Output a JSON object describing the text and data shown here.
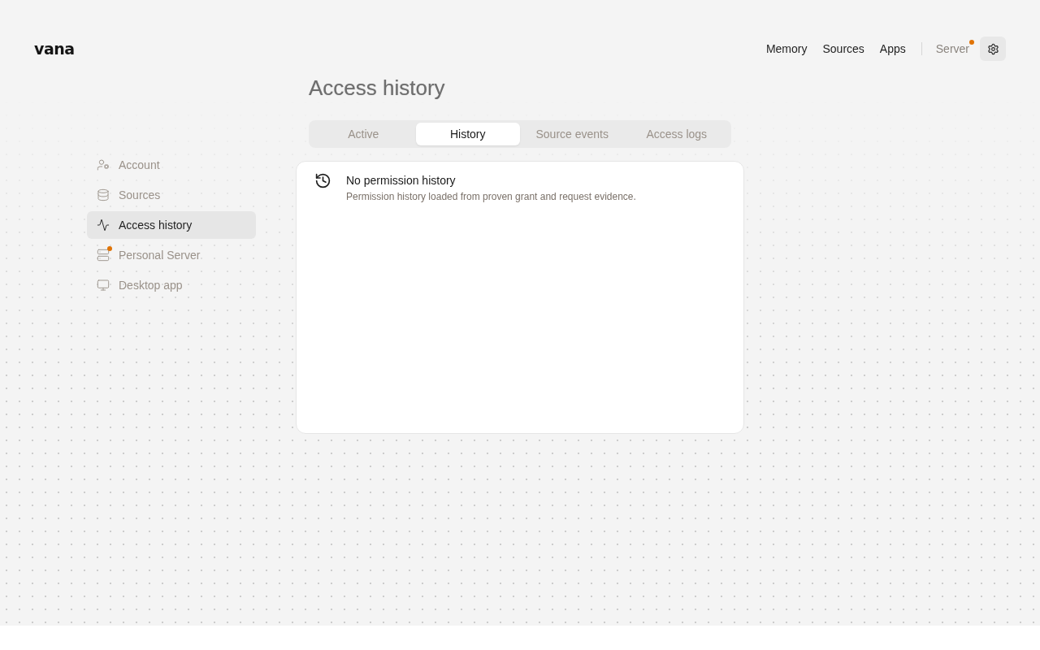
{
  "logo": {
    "text": "vana"
  },
  "nav": {
    "links": [
      {
        "label": "Memory"
      },
      {
        "label": "Sources"
      },
      {
        "label": "Apps"
      }
    ],
    "server": {
      "label": "Server",
      "notification": true
    }
  },
  "sidebar": {
    "items": [
      {
        "label": "Account",
        "selected": false,
        "notification": false
      },
      {
        "label": "Sources",
        "selected": false,
        "notification": false
      },
      {
        "label": "Access history",
        "selected": true,
        "notification": false
      },
      {
        "label": "Personal Server",
        "selected": false,
        "notification": true
      },
      {
        "label": "Desktop app",
        "selected": false,
        "notification": false
      }
    ]
  },
  "page": {
    "title": "Access history"
  },
  "tabs": [
    {
      "label": "Active",
      "selected": false
    },
    {
      "label": "History",
      "selected": true
    },
    {
      "label": "Source events",
      "selected": false
    },
    {
      "label": "Access logs",
      "selected": false
    }
  ],
  "empty_state": {
    "title": "No permission history",
    "description": "Permission history loaded from proven grant and request evidence."
  }
}
